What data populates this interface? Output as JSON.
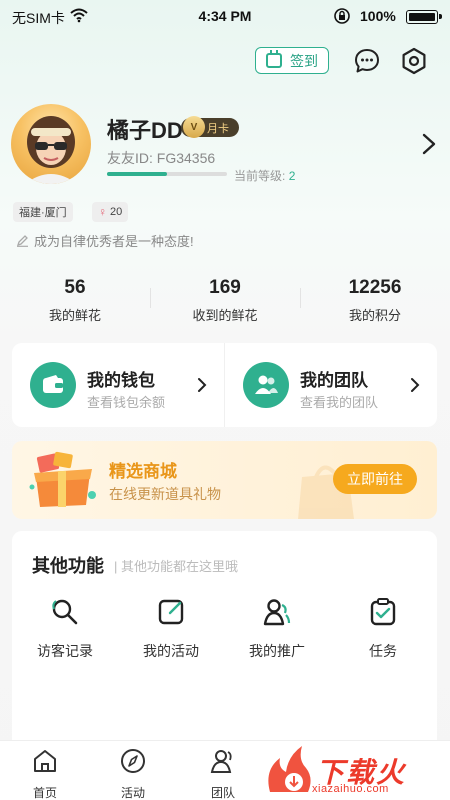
{
  "status_bar": {
    "carrier": "无SIM卡",
    "time": "4:34 PM",
    "battery": "100%"
  },
  "header": {
    "checkin_label": "签到"
  },
  "profile": {
    "name": "橘子DD",
    "vip_label": "月卡",
    "user_id": "友友ID: FG34356",
    "level_label": "当前等级:",
    "level_value": "2",
    "level_progress": 0.5,
    "city_tag": "福建·厦门",
    "age": "20",
    "signature": "成为自律优秀者是一种态度!"
  },
  "stats": [
    {
      "value": "56",
      "label": "我的鲜花"
    },
    {
      "value": "169",
      "label": "收到的鲜花"
    },
    {
      "value": "12256",
      "label": "我的积分"
    }
  ],
  "wallet": {
    "title": "我的钱包",
    "subtitle": "查看钱包余额"
  },
  "team": {
    "title": "我的团队",
    "subtitle": "查看我的团队"
  },
  "mall": {
    "title": "精选商城",
    "subtitle": "在线更新道具礼物",
    "button": "立即前往"
  },
  "other": {
    "title": "其他功能",
    "subtitle": "| 其他功能都在这里哦",
    "items": [
      {
        "label": "访客记录",
        "icon": "visitor-record-icon"
      },
      {
        "label": "我的活动",
        "icon": "my-activity-icon"
      },
      {
        "label": "我的推广",
        "icon": "my-promotion-icon"
      },
      {
        "label": "任务",
        "icon": "task-icon"
      }
    ]
  },
  "bottom_nav": [
    {
      "label": "首页",
      "icon": "home-icon"
    },
    {
      "label": "活动",
      "icon": "compass-icon"
    },
    {
      "label": "团队",
      "icon": "team-icon"
    }
  ],
  "watermark": {
    "text": "下载火",
    "url": "xiazaihuo.com"
  },
  "colors": {
    "accent": "#2fb08f",
    "mall": "#f6a91e",
    "watermark": "#ec3a2b"
  }
}
